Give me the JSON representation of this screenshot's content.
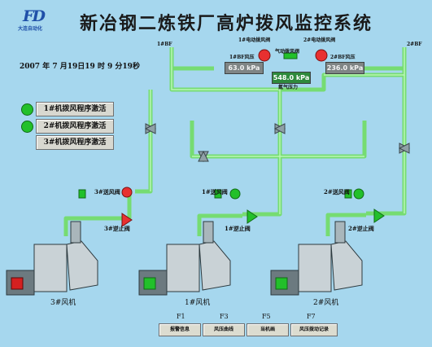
{
  "logo": {
    "mark": "FD",
    "subtitle": "大连自动化"
  },
  "title": "新冶钢二炼铁厂高炉拨风监控系统",
  "datetime": "2007 年  7 月19日19 时  9 分19秒",
  "programs": [
    {
      "label": "1#机拨风程序激活",
      "lamp": true
    },
    {
      "label": "2#机拨风程序激活",
      "lamp": true
    },
    {
      "label": "3#机拨风程序激活",
      "lamp": false
    }
  ],
  "header_pipes": {
    "left": "1#BF",
    "right": "2#BF"
  },
  "pressures": {
    "bf1_label": "1#BF风压",
    "bf1_value": "63.0 kPa",
    "bf2_label": "2#BF风压",
    "bf2_value": "236.0 kPa",
    "air_label": "氮气压力",
    "air_value": "548.0 kPa",
    "valve1_label": "1#电动拨风阀",
    "valve2_label": "2#电动拨风阀",
    "gas_valve_label": "气动拨风阀"
  },
  "fans": [
    {
      "name": "3#风机",
      "motor_color": "#d42020",
      "vent_label": "3#送风阀",
      "stop_label": "3#逆止阀"
    },
    {
      "name": "1#风机",
      "motor_color": "#22c02a",
      "vent_label": "1#送风阀",
      "stop_label": "1#逆止阀"
    },
    {
      "name": "2#风机",
      "motor_color": "#22c02a",
      "vent_label": "2#送风阀",
      "stop_label": "2#逆止阀"
    }
  ],
  "footer": [
    {
      "key": "F1",
      "label": "报警信息"
    },
    {
      "key": "F3",
      "label": "风压曲线"
    },
    {
      "key": "F5",
      "label": "当机画"
    },
    {
      "key": "F7",
      "label": "风压拨动记录"
    }
  ],
  "colors": {
    "background": "#a6d7ee",
    "pipe": "#7de07a",
    "pipe_edge": "#3f9e3d",
    "valve_red": "#e83030",
    "lamp_green": "#22c02a"
  }
}
